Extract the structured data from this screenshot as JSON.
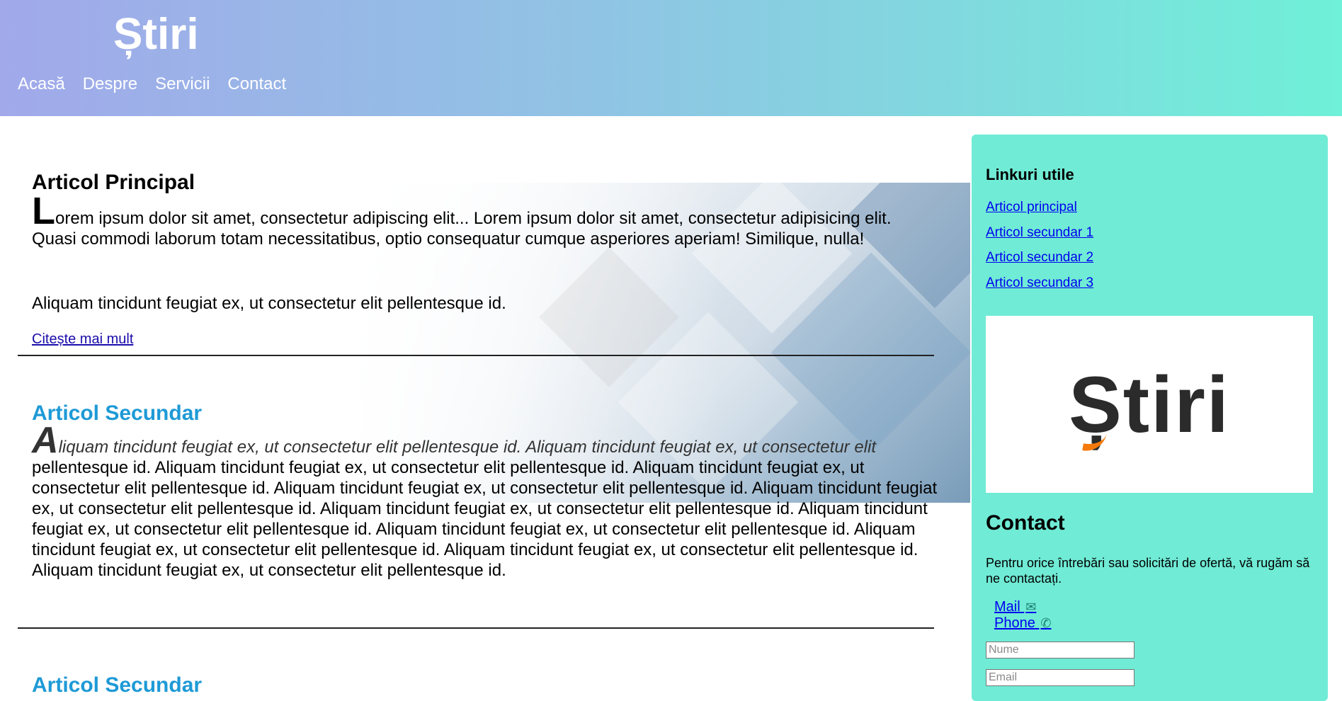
{
  "header": {
    "title": "Știri",
    "nav": [
      "Acasă",
      "Despre",
      "Servicii",
      "Contact"
    ]
  },
  "main": {
    "article_title": "Articol Principal",
    "article_dropcap": "L",
    "article_p1": "orem ipsum dolor sit amet, consectetur adipiscing elit... Lorem ipsum dolor sit amet, consectetur adipisicing elit. Quasi commodi laborum totam necessitatibus, optio consequatur cumque asperiores aperiam! Similique, nulla!",
    "article_p2": "Aliquam tincidunt feugiat ex, ut consectetur elit pellentesque id.",
    "read_more": "Citește mai mult",
    "secondary_title_1": "Articol Secundar",
    "secondary_dropcap": "A",
    "secondary_lead": "liquam tincidunt feugiat ex, ut consectetur elit pellentesque id. Aliquam tincidunt feugiat ex, ut consectetur elit",
    "secondary_body": " pellentesque id. Aliquam tincidunt feugiat ex, ut consectetur elit pellentesque id. Aliquam tincidunt feugiat ex, ut consectetur elit pellentesque id. Aliquam tincidunt feugiat ex, ut consectetur elit pellentesque id. Aliquam tincidunt feugiat ex, ut consectetur elit pellentesque id. Aliquam tincidunt feugiat ex, ut consectetur elit pellentesque id. Aliquam tincidunt feugiat ex, ut consectetur elit pellentesque id. Aliquam tincidunt feugiat ex, ut consectetur elit pellentesque id. Aliquam tincidunt feugiat ex, ut consectetur elit pellentesque id. Aliquam tincidunt feugiat ex, ut consectetur elit pellentesque id. Aliquam tincidunt feugiat ex, ut consectetur elit pellentesque id.",
    "secondary_title_2": "Articol Secundar"
  },
  "sidebar": {
    "links_title": "Linkuri utile",
    "links": [
      "Articol principal",
      "Articol secundar 1",
      "Articol secundar 2",
      "Articol secundar 3"
    ],
    "logo_text": "Știri",
    "contact_title": "Contact",
    "contact_text": "Pentru orice întrebări sau solicitări de ofertă, vă rugăm să ne contactați.",
    "mail_label": "Mail",
    "phone_label": "Phone",
    "name_placeholder": "Nume",
    "email_placeholder": "Email"
  },
  "icons": {
    "mail": "envelope-icon",
    "phone": "phone-icon"
  },
  "colors": {
    "accent": "#1e9ad6",
    "sidebar_bg": "#70ebd5",
    "header_start": "#a1a9ea",
    "header_end": "#6ff0d8",
    "logo_orange": "#f57a0b"
  }
}
